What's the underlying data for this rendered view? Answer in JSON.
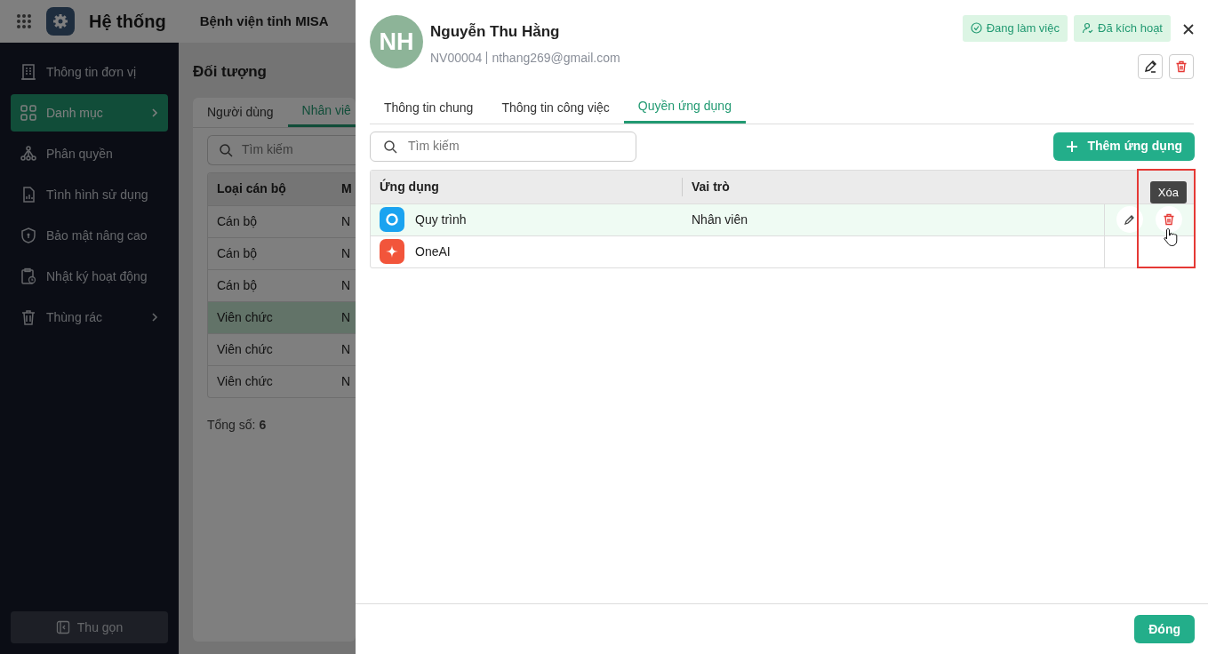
{
  "topbar": {
    "app_title": "Hệ thống",
    "org": "Bệnh viện tỉnh MISA"
  },
  "sidebar": {
    "items": [
      {
        "label": "Thông tin đơn vị",
        "selected": false,
        "has_submenu": false
      },
      {
        "label": "Danh mục",
        "selected": true,
        "has_submenu": true
      },
      {
        "label": "Phân quyền",
        "selected": false,
        "has_submenu": false
      },
      {
        "label": "Tình hình sử dụng",
        "selected": false,
        "has_submenu": false
      },
      {
        "label": "Bảo mật nâng cao",
        "selected": false,
        "has_submenu": false
      },
      {
        "label": "Nhật ký hoạt động",
        "selected": false,
        "has_submenu": false
      },
      {
        "label": "Thùng rác",
        "selected": false,
        "has_submenu": true
      }
    ],
    "collapse": "Thu gọn"
  },
  "page": {
    "title": "Đối tượng",
    "tabs": [
      {
        "label": "Người dùng",
        "selected": false
      },
      {
        "label": "Nhân viê",
        "selected": true
      }
    ],
    "search": {
      "placeholder": "Tìm kiếm"
    },
    "table": {
      "columns": [
        "Loại cán bộ",
        "M"
      ],
      "rows": [
        {
          "cells": [
            "Cán bộ",
            "N"
          ],
          "selected": false
        },
        {
          "cells": [
            "Cán bộ",
            "N"
          ],
          "selected": false
        },
        {
          "cells": [
            "Cán bộ",
            "N"
          ],
          "selected": false
        },
        {
          "cells": [
            "Viên chức",
            "N"
          ],
          "selected": true
        },
        {
          "cells": [
            "Viên chức",
            "N"
          ],
          "selected": false
        },
        {
          "cells": [
            "Viên chức",
            "N"
          ],
          "selected": false
        }
      ]
    },
    "total_label": "Tổng số:",
    "total": "6"
  },
  "drawer": {
    "avatar": "NH",
    "name": "Nguyễn Thu Hằng",
    "code": "NV00004",
    "email": "nthang269@gmail.com",
    "badges": [
      {
        "label": "Đang làm việc"
      },
      {
        "label": "Đã kích hoạt"
      }
    ],
    "tabs": [
      {
        "label": "Thông tin chung",
        "selected": false
      },
      {
        "label": "Thông tin công việc",
        "selected": false
      },
      {
        "label": "Quyền ứng dụng",
        "selected": true
      }
    ],
    "search": {
      "placeholder": "Tìm kiếm"
    },
    "add_button": "Thêm ứng dụng",
    "table": {
      "columns": [
        "Ứng dụng",
        "Vai trò"
      ],
      "rows": [
        {
          "app": "Quy trình",
          "color": "#1aa3f0",
          "role": "Nhân viên",
          "selected": true,
          "tooltip": "Xóa"
        },
        {
          "app": "OneAI",
          "color": "#f2553b",
          "selected": false
        }
      ]
    },
    "close_button": "Đóng"
  }
}
